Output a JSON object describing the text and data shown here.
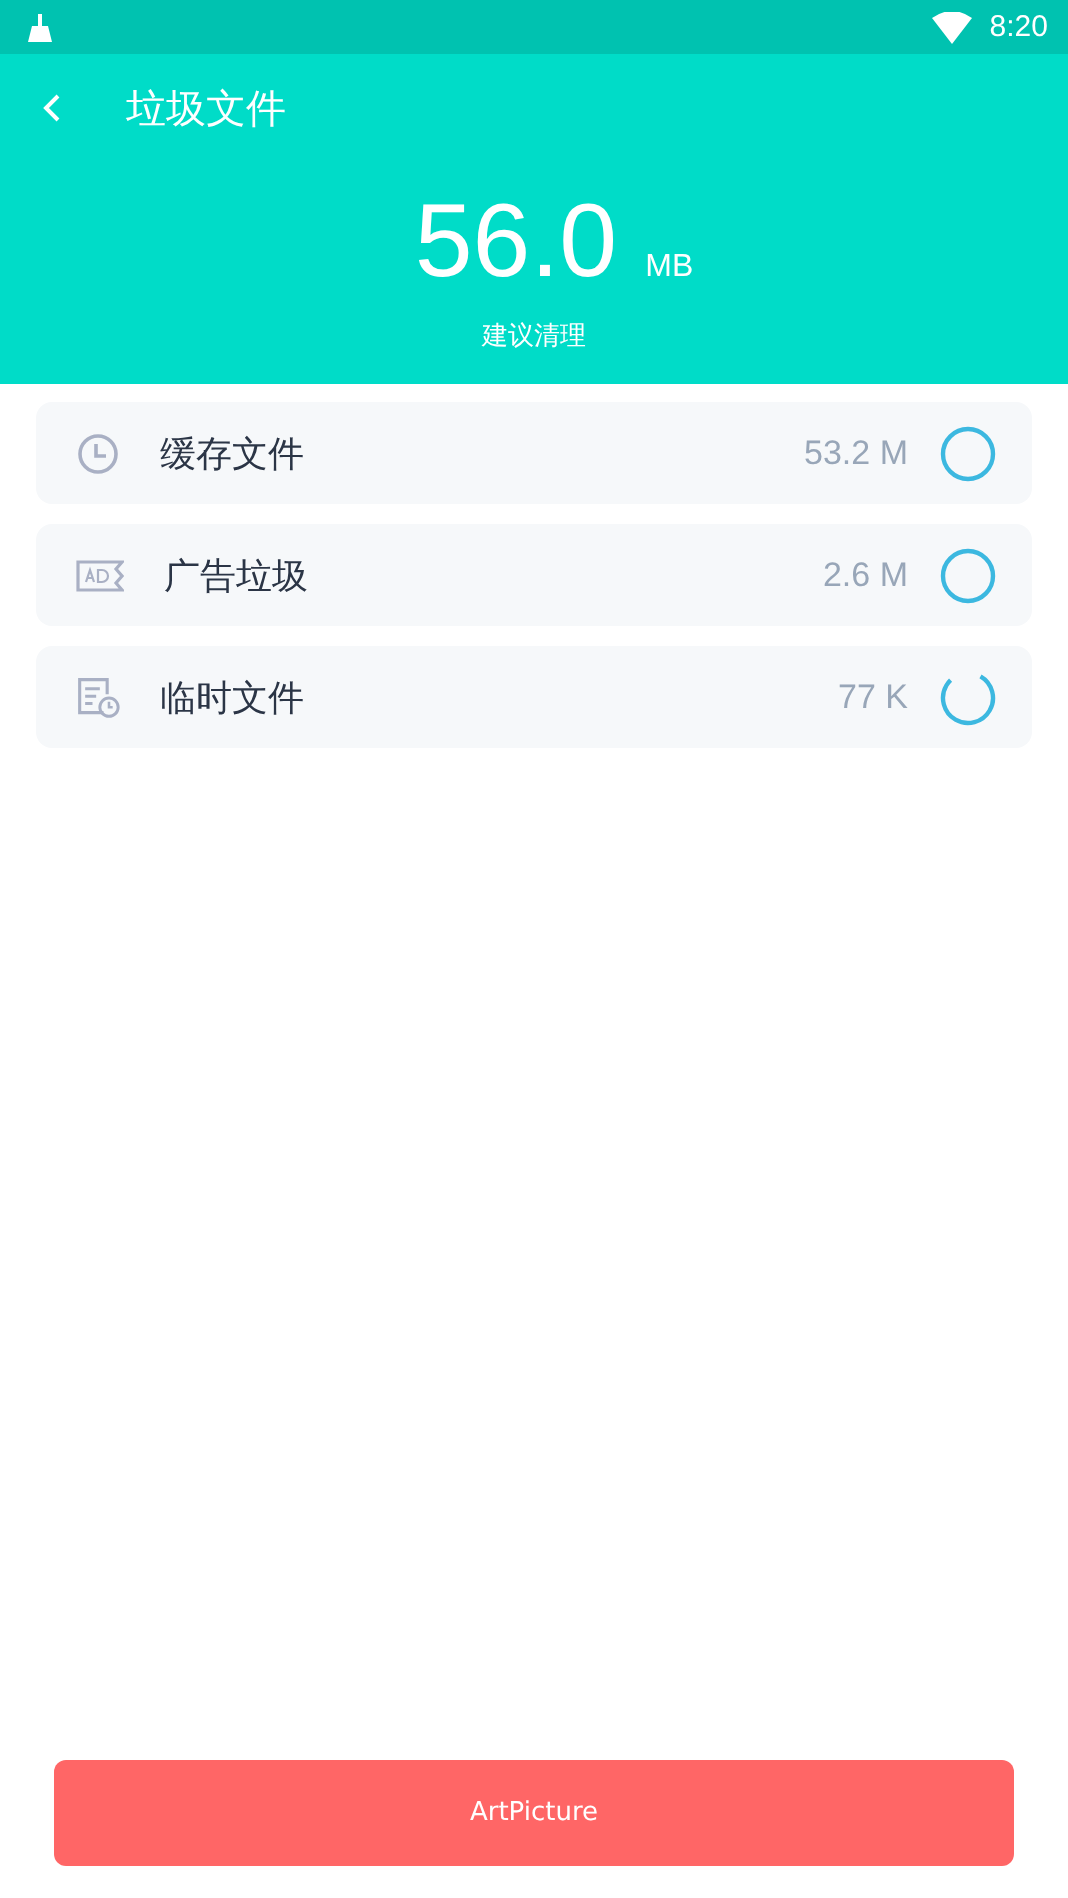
{
  "status_bar": {
    "time": "8:20"
  },
  "header": {
    "title": "垃圾文件",
    "total": "56.0",
    "unit": "MB",
    "hint": "建议清理"
  },
  "items": [
    {
      "kind": "cache",
      "label": "缓存文件",
      "size": "53.2 M",
      "scanning": false
    },
    {
      "kind": "ad",
      "label": "广告垃圾",
      "size": "2.6 M",
      "scanning": false
    },
    {
      "kind": "temp",
      "label": "临时文件",
      "size": "77 K",
      "scanning": true
    }
  ],
  "button": {
    "label": "ArtPicture"
  }
}
